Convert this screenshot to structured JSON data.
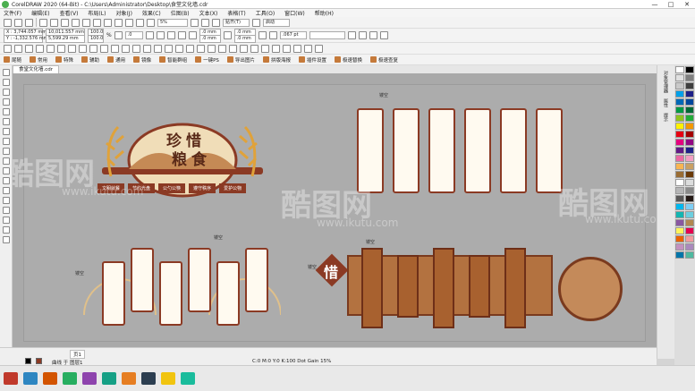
{
  "window": {
    "title": "CorelDRAW 2020 (64-Bit) - C:\\Users\\Administrator\\Desktop\\食堂文化墙.cdr",
    "minimize": "—",
    "maximize": "□",
    "close": "✕"
  },
  "menu": [
    "文件(F)",
    "编辑(E)",
    "查看(V)",
    "布局(L)",
    "对象(J)",
    "效果(C)",
    "位图(B)",
    "文本(X)",
    "表格(T)",
    "工具(O)",
    "窗口(W)",
    "帮助(H)"
  ],
  "toolbar": {
    "zoom": "5%",
    "snap": "贴齐(T)",
    "launch": "启动"
  },
  "props": {
    "x": "X : 3,744.057 mm",
    "y": "Y : -1,332.576 mm",
    "w": "10,011.557 mm",
    "h": "5,599.29 mm",
    "sx": "100.0",
    "sy": "100.0",
    "pct": "%",
    "angle": ".0",
    "mm1": ".0 mm",
    "mm2": ".0 mm",
    "mm3": ".0 mm",
    "mm4": ".0 mm",
    "outline": ".067 pt"
  },
  "plugins": [
    "尾随",
    "常用",
    "特殊",
    "辅助",
    "通用",
    "镜像",
    "智能群组",
    "一键PS",
    "导出图片",
    "拼版海报",
    "插件设置",
    "极速替换",
    "极速查复"
  ],
  "document_tab": "食堂文化墙.cdr",
  "design": {
    "title_chars": [
      "珍",
      "惜",
      "粮",
      "食"
    ],
    "pills": [
      "文明就餐",
      "节约光盘",
      "公勺公筷",
      "遵守秩序",
      "爱护公物"
    ],
    "hole_label": "镂空",
    "xi_char": "惜"
  },
  "watermark": {
    "brand": "酷图网",
    "url": "www.ikutu.com"
  },
  "right_panel": [
    "对象管理器",
    "属性",
    "提示"
  ],
  "status": {
    "page": "页1",
    "text": "曲线 于 图层1",
    "right": "C:0 M:0 Y:0 K:100 Dot Gain 15%"
  },
  "colors": {
    "brand_brown": "#8b3a24",
    "canvas": "#a9a9a9",
    "accent_orange": "#e0a23a"
  },
  "palette": [
    "#ffffff",
    "#000000",
    "#e0e0e0",
    "#7f7f7f",
    "#c9c9c9",
    "#3f3f3f",
    "#00a0e9",
    "#1d2088",
    "#0068b7",
    "#00479d",
    "#009944",
    "#006934",
    "#8fc31f",
    "#22ac38",
    "#fff100",
    "#f39800",
    "#e60012",
    "#a40000",
    "#e4007f",
    "#920783",
    "#601986",
    "#1d2088",
    "#ea68a2",
    "#f19ec2",
    "#f8b551",
    "#c9a063",
    "#996c33",
    "#6a3906",
    "#ffffff",
    "#dcdddd",
    "#b5b5b6",
    "#898989",
    "#595757",
    "#231815",
    "#00b7ee",
    "#7ecef4",
    "#13b5b1",
    "#6ccfe0",
    "#8957a1",
    "#b28850",
    "#fff45c",
    "#e5004f",
    "#eb6100",
    "#f29c9f",
    "#c490bf",
    "#aa89bd",
    "#0075a9",
    "#4fb9a0"
  ]
}
